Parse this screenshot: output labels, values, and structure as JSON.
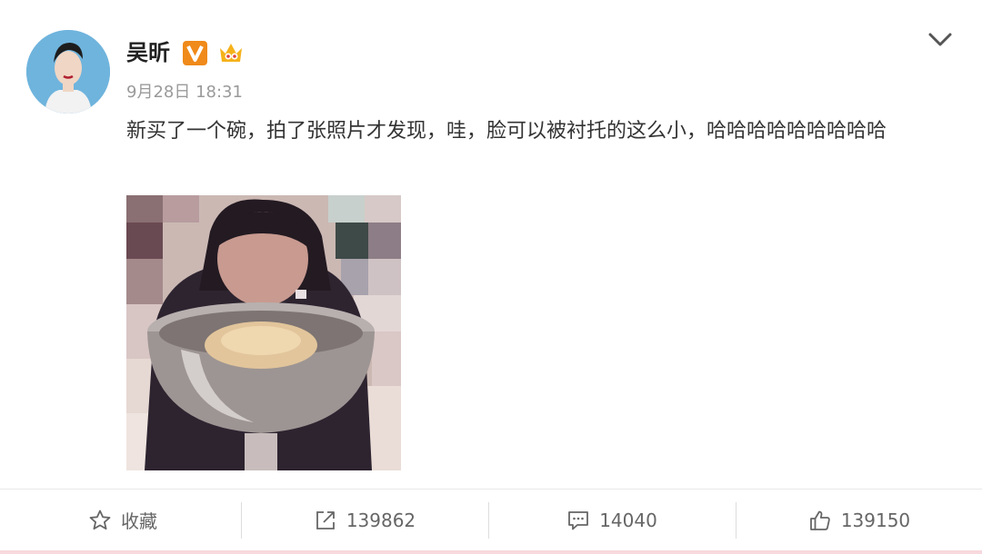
{
  "post": {
    "author": "吴昕",
    "timestamp": "9月28日 18:31",
    "text": "新买了一个碗，拍了张照片才发现，哇，脸可以被衬托的这么小，哈哈哈哈哈哈哈哈哈",
    "icons": {
      "avatar": "user-avatar",
      "verified": "verified-v-icon",
      "member": "crown-member-icon",
      "menu": "chevron-down-icon"
    }
  },
  "actions": {
    "favorite": {
      "label": "收藏",
      "icon": "star-icon"
    },
    "repost": {
      "label": "139862",
      "icon": "share-icon"
    },
    "comment": {
      "label": "14040",
      "icon": "comment-icon"
    },
    "like": {
      "label": "139150",
      "icon": "thumbs-up-icon"
    }
  },
  "colors": {
    "verified_badge": "#f08a1a",
    "meta_gray": "#9a9a9a",
    "action_gray": "#666666",
    "bottom_accent": "#f7d8dd"
  }
}
